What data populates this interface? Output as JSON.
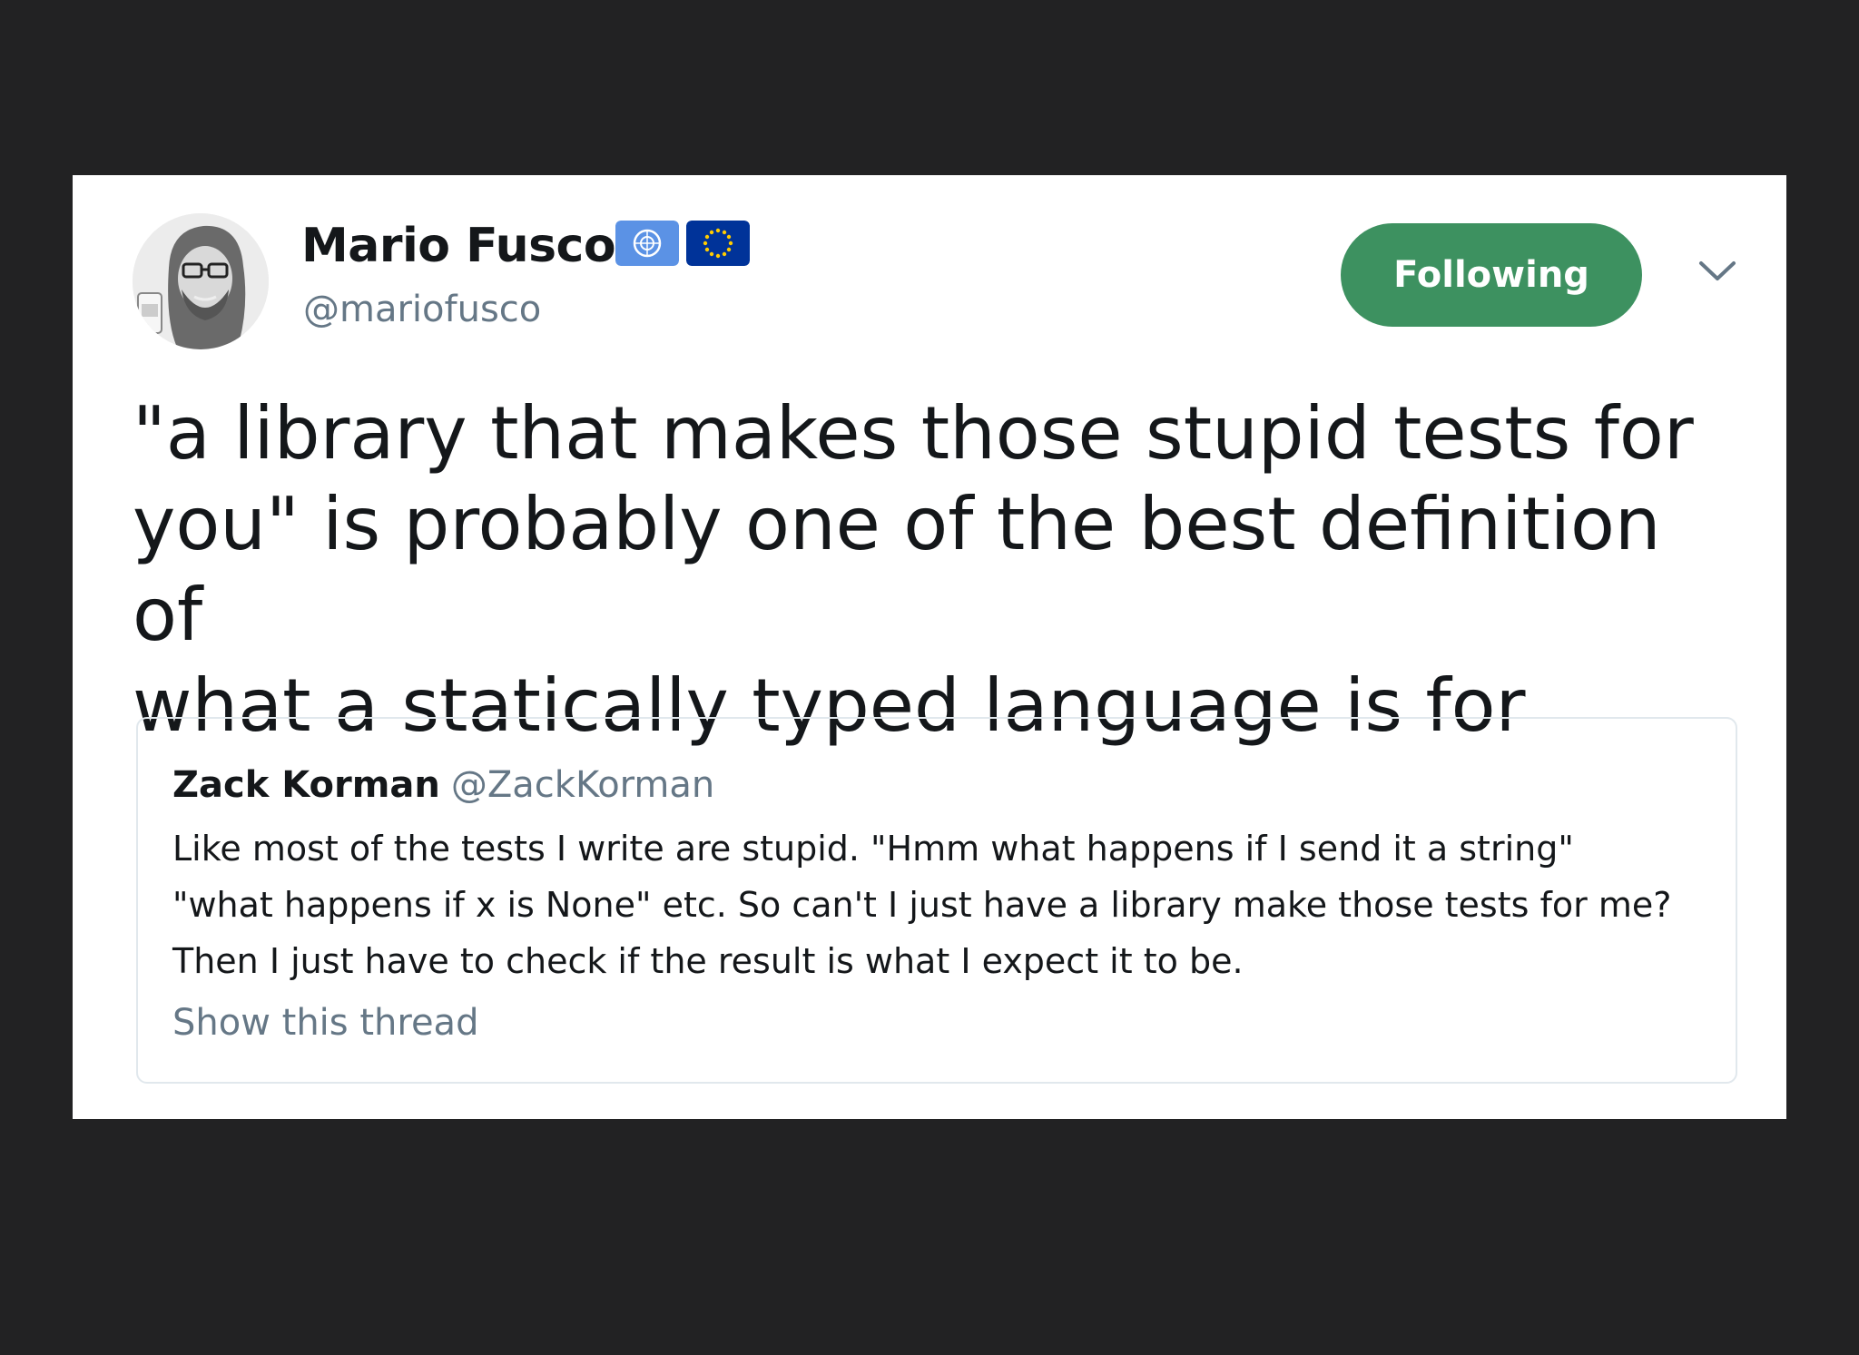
{
  "author": {
    "display_name": "Mario Fusco",
    "handle": "@mariofusco",
    "badges": [
      "un-flag-icon",
      "eu-flag-icon"
    ]
  },
  "follow_button": {
    "label": "Following",
    "color": "#3d9160"
  },
  "menu": {
    "icon": "chevron-down-icon"
  },
  "tweet": {
    "text": "\"a library that makes those stupid tests for\nyou\" is probably one of the best definition of\nwhat a statically typed language is for"
  },
  "quoted_tweet": {
    "display_name": "Zack Korman",
    "handle": "@ZackKorman",
    "text": "Like most of the tests I write are stupid. \"Hmm what happens if I send it a string\"\n\"what happens if x is None\" etc. So can't I just have a library make those tests for me?\nThen I just have to check if the result is what I expect it to be.",
    "show_thread_label": "Show this thread"
  },
  "colors": {
    "background": "#222223",
    "card": "#ffffff",
    "text_primary": "#14171a",
    "text_secondary": "#657786",
    "border": "#e1e8ed",
    "un_blue": "#5b92e5",
    "eu_blue": "#003399",
    "eu_stars": "#ffcc00"
  }
}
